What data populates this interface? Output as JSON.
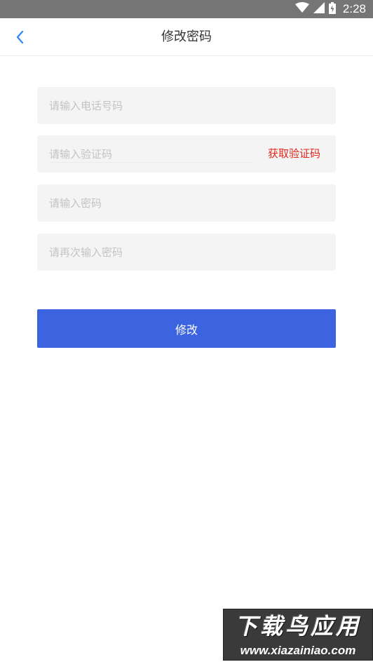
{
  "status_bar": {
    "time": "2:28"
  },
  "header": {
    "title": "修改密码"
  },
  "form": {
    "phone_placeholder": "请输入电话号码",
    "code_placeholder": "请输入验证码",
    "get_code_label": "获取验证码",
    "password_placeholder": "请输入密码",
    "password_confirm_placeholder": "请再次输入密码",
    "submit_label": "修改"
  },
  "watermark": {
    "title": "下载鸟应用",
    "url": "www.xiazainiao.com"
  },
  "colors": {
    "accent": "#3c63e0",
    "link_red": "#e0281c",
    "back_icon": "#2b88f0",
    "status_bar": "#757575"
  }
}
